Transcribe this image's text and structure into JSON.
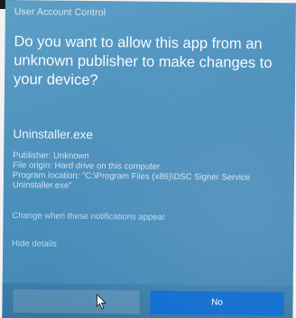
{
  "dialog": {
    "title": "User Account Control",
    "question": "Do you want to allow this app from an unknown publisher to make changes to your device?",
    "app_name": "Uninstaller.exe",
    "details": {
      "publisher": "Publisher: Unknown",
      "file_origin": "File origin: Hard drive on this computer",
      "program_location": "Program location: \"C:\\Program Files (x86)\\DSC Signer Service",
      "program_location_cont": "Uninstaller.exe\""
    },
    "change_link": "Change when these notifications appear",
    "hide_details_link": "Hide details",
    "buttons": {
      "yes": "",
      "no": "No"
    }
  },
  "colors": {
    "dialog_background": "#4c90bc",
    "no_button": "#0b6ad0",
    "link": "#b9dbf3"
  },
  "icons": {
    "cursor": "mouse-pointer-icon"
  }
}
